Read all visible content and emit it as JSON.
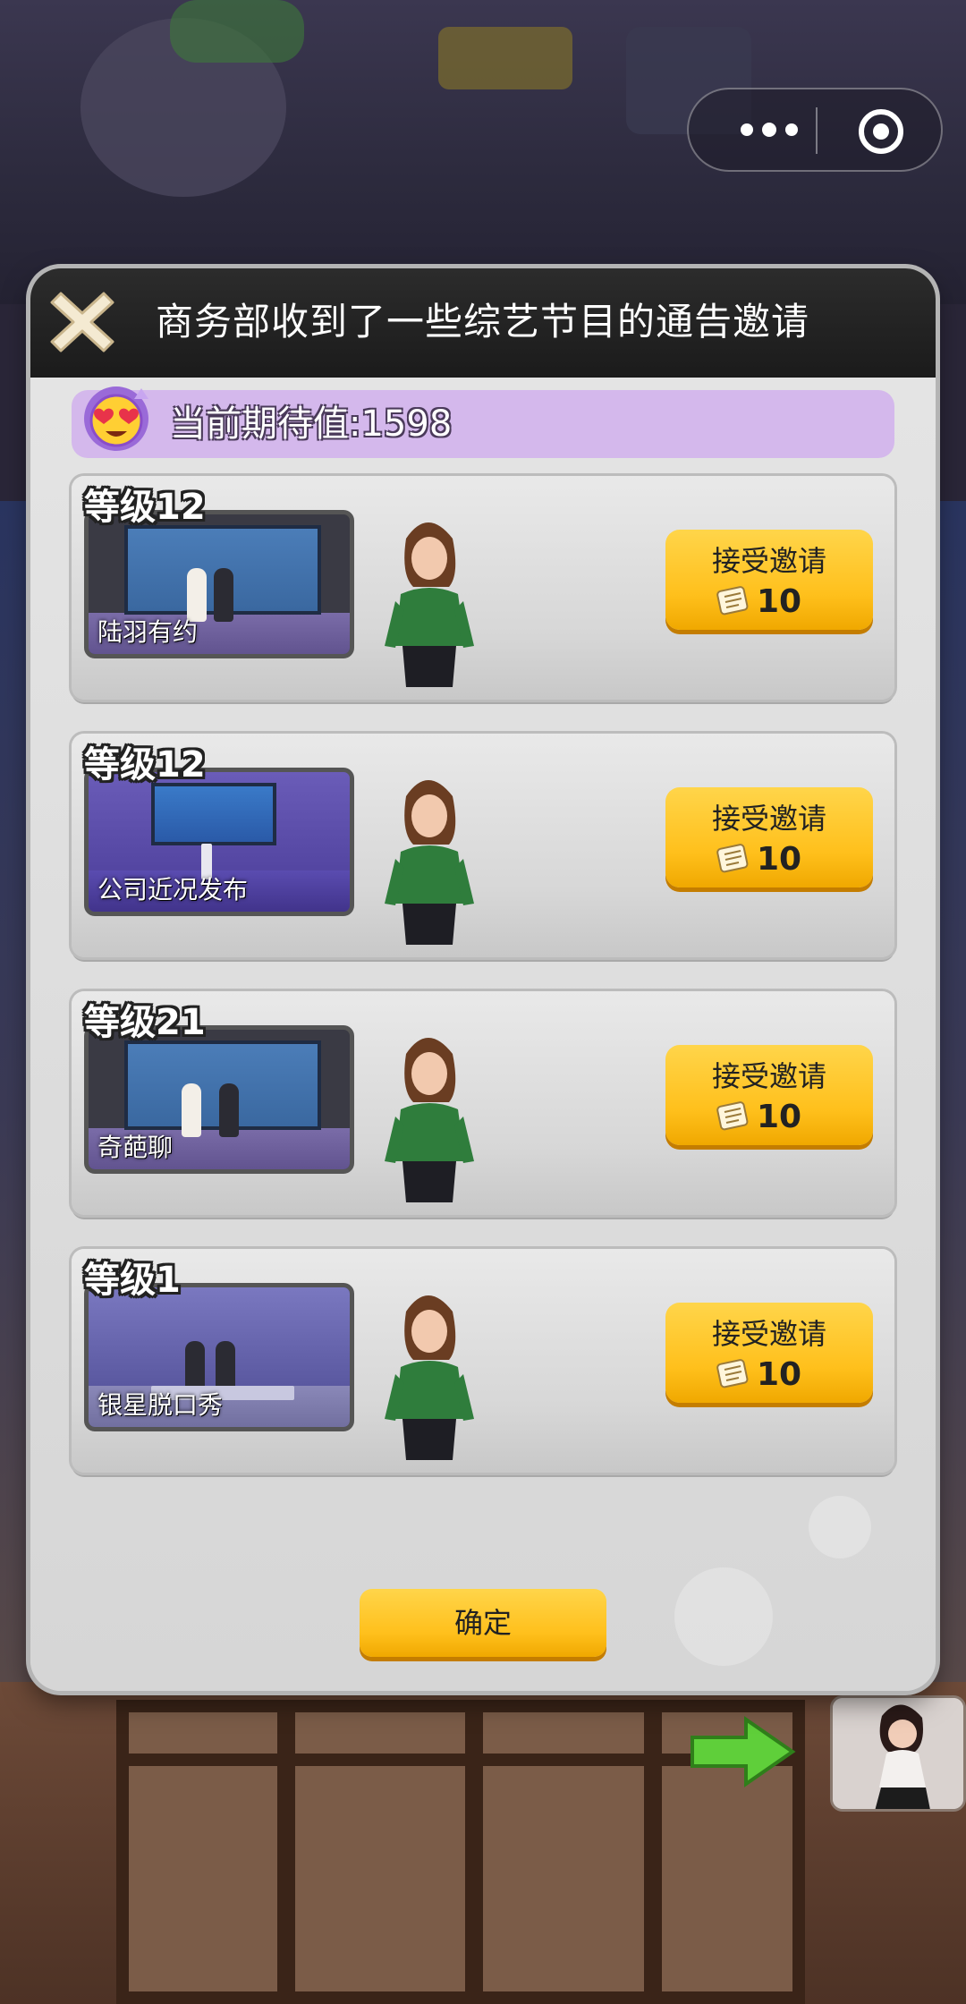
{
  "dialog": {
    "title": "商务部收到了一些综艺节目的通告邀请",
    "expectation_text": "当前期待值:1598",
    "confirm_label": "确定"
  },
  "shows": [
    {
      "level": "等级12",
      "name": "陆羽有约",
      "accept_label": "接受邀请",
      "cost": "10"
    },
    {
      "level": "等级12",
      "name": "公司近况发布",
      "accept_label": "接受邀请",
      "cost": "10"
    },
    {
      "level": "等级21",
      "name": "奇葩聊",
      "accept_label": "接受邀请",
      "cost": "10"
    },
    {
      "level": "等级1",
      "name": "银星脱口秀",
      "accept_label": "接受邀请",
      "cost": "10"
    }
  ],
  "colors": {
    "accent_yellow": "#ffc01c",
    "expect_bar": "#d4b8ec",
    "header_dark": "#1b1b1b"
  },
  "icons": [
    "more-dots-icon",
    "capsule-close-icon",
    "close-x-icon",
    "heart-eyes-emoji-icon",
    "scroll-ticket-icon",
    "green-arrow-icon"
  ]
}
